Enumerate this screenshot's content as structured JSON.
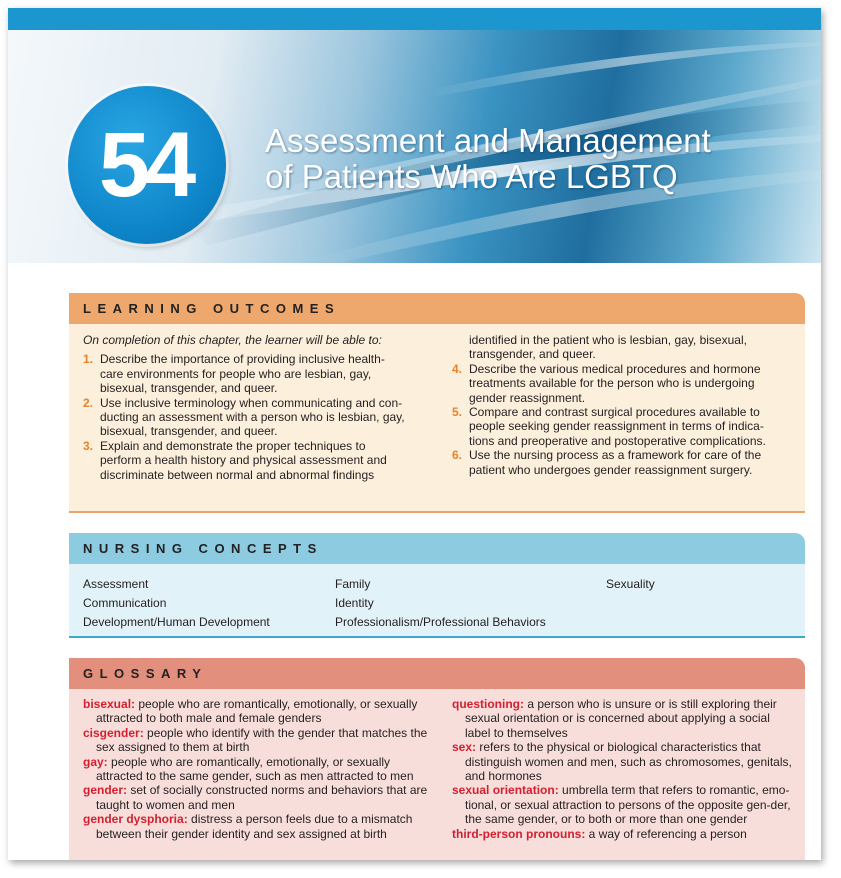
{
  "chapter": {
    "number": "54",
    "title_line1": "Assessment and Management",
    "title_line2": "of Patients Who Are LGBTQ"
  },
  "learning_outcomes": {
    "heading": "LEARNING OUTCOMES",
    "intro": "On completion of this chapter, the learner will be able to:",
    "items": [
      {
        "num": "1.",
        "lines": [
          "Describe the importance of providing inclusive health-",
          "care environments for people who are lesbian, gay,",
          "bisexual, transgender, and queer."
        ]
      },
      {
        "num": "2.",
        "lines": [
          "Use inclusive terminology when communicating and con-",
          "ducting an assessment with a person who is lesbian, gay,",
          "bisexual, transgender, and queer."
        ]
      },
      {
        "num": "3.",
        "lines": [
          "Explain and demonstrate the proper techniques to",
          "perform a health history and physical assessment and",
          "discriminate between normal and abnormal findings"
        ]
      },
      {
        "num": "4.",
        "lines": [
          "Describe the various medical procedures and hormone",
          "treatments available for the person who is undergoing",
          "gender reassignment."
        ]
      },
      {
        "num": "5.",
        "lines": [
          "Compare and contrast surgical procedures available to",
          "people seeking gender reassignment in terms of indica-",
          "tions and preoperative and postoperative complications."
        ]
      },
      {
        "num": "6.",
        "lines": [
          "Use the nursing process as a framework for care of the",
          "patient who undergoes gender reassignment surgery."
        ]
      }
    ],
    "continuation_lines": [
      "identified in the patient who is lesbian, gay, bisexual,",
      "transgender, and queer."
    ]
  },
  "nursing_concepts": {
    "heading": "NURSING CONCEPTS",
    "columns": [
      [
        "Assessment",
        "Communication",
        "Development/Human Development"
      ],
      [
        "Family",
        "Identity",
        "Professionalism/Professional Behaviors"
      ],
      [
        "Sexuality"
      ]
    ]
  },
  "glossary": {
    "heading": "GLOSSARY",
    "left": [
      {
        "term": "bisexual:",
        "def": " people who are romantically, emotionally, or sexually attracted to both male and female genders"
      },
      {
        "term": "cisgender:",
        "def": " people who identify with the gender that matches the sex assigned to them at birth"
      },
      {
        "term": "gay:",
        "def": " people who are romantically, emotionally, or sexually attracted to the same gender, such as men attracted to men"
      },
      {
        "term": "gender:",
        "def": " set of socially constructed norms and behaviors that are taught to women and men"
      },
      {
        "term": "gender dysphoria:",
        "def": " distress a person feels due to a mismatch between their gender identity and sex assigned at birth"
      }
    ],
    "right": [
      {
        "term": "questioning:",
        "def": " a person who is unsure or is still exploring their sexual orientation or is concerned about applying a social label to themselves"
      },
      {
        "term": "sex:",
        "def": " refers to the physical or biological characteristics that distinguish women and men, such as chromosomes, genitals, and hormones"
      },
      {
        "term": "sexual orientation:",
        "def": " umbrella term that refers to romantic, emo-tional, or sexual attraction to persons of the opposite gen-der, the same gender, or to both or more than one gender"
      },
      {
        "term": "third-person pronouns:",
        "def": " a way of referencing a person"
      }
    ]
  },
  "colors": {
    "top_bar": "#1c96cf",
    "badge": "#0d84c8",
    "outcomes_header": "#eea86d",
    "concepts_header": "#8ccbe0",
    "glossary_header": "#e38f7e",
    "term_red": "#d22030",
    "number_orange": "#e8832b"
  }
}
